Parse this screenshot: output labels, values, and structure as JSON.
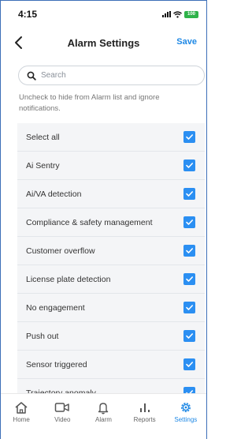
{
  "status_bar": {
    "time": "4:15",
    "battery": "100"
  },
  "header": {
    "title": "Alarm Settings",
    "save_label": "Save"
  },
  "search": {
    "placeholder": "Search",
    "value": ""
  },
  "hint": "Uncheck to hide from Alarm list and ignore notifications.",
  "alarm_types": [
    {
      "label": "Select all",
      "checked": true
    },
    {
      "label": "Ai Sentry",
      "checked": true
    },
    {
      "label": "Ai/VA detection",
      "checked": true
    },
    {
      "label": "Compliance & safety management",
      "checked": true
    },
    {
      "label": "Customer overflow",
      "checked": true
    },
    {
      "label": "License plate detection",
      "checked": true
    },
    {
      "label": "No engagement",
      "checked": true
    },
    {
      "label": "Push out",
      "checked": true
    },
    {
      "label": "Sensor triggered",
      "checked": true
    },
    {
      "label": "Trajectory anomaly",
      "checked": true
    }
  ],
  "tabs": [
    {
      "label": "Home",
      "icon": "home-icon",
      "active": false
    },
    {
      "label": "Video",
      "icon": "video-icon",
      "active": false
    },
    {
      "label": "Alarm",
      "icon": "bell-icon",
      "active": false
    },
    {
      "label": "Reports",
      "icon": "bar-chart-icon",
      "active": false
    },
    {
      "label": "Settings",
      "icon": "gear-icon",
      "active": true
    }
  ],
  "colors": {
    "accent": "#1e88e5",
    "checkbox": "#2b8ff2",
    "list_bg": "#f4f5f7",
    "battery": "#2fb34a"
  }
}
